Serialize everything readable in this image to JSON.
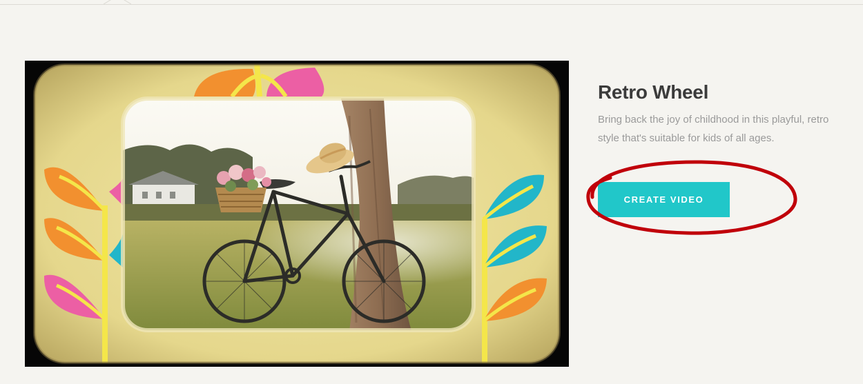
{
  "template": {
    "title": "Retro Wheel",
    "description": "Bring back the joy of childhood in this playful, retro style that's suitable for kids of all ages.",
    "cta_label": "CREATE VIDEO"
  },
  "annotation": {
    "type": "red-ellipse",
    "color": "#c0000a"
  },
  "colors": {
    "page_bg": "#f5f4f0",
    "cta_bg": "#21c7c9",
    "title": "#3b3b3b",
    "desc": "#9a9a9a"
  }
}
